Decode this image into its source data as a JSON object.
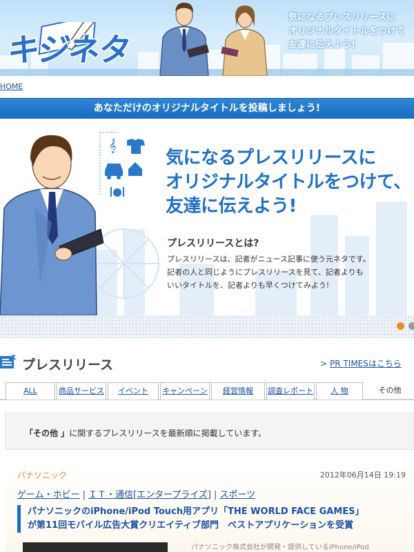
{
  "header": {
    "logo_text": "キジネタ",
    "tagline_lines": [
      "気になるプレスリリースに",
      "オリジナルタイトルをつけて",
      "友達に伝えよう!"
    ]
  },
  "breadcrumb": {
    "home": "HOME"
  },
  "banner": {
    "text": "あなただけのオリジナルタイトルを投稿しましょう!"
  },
  "hero": {
    "title_lines": [
      "気になるプレスリリースに",
      "オリジナルタイトルをつけて、",
      "友達に伝えよう!"
    ],
    "subheading": "プレスリリースとは?",
    "description_lines": [
      "プレスリリースは、記者がニュース記事に使う元ネタです。",
      "記者の人と同じようにプレスリリースを見て、記者よりも",
      "いいタイトルを、記者よりも早くつけてみよう!"
    ]
  },
  "slider": {
    "dots": 2,
    "active_index": 0
  },
  "press": {
    "section_title": "プレスリリース",
    "prtimes_link": "PR TIMESはこちら",
    "tabs": [
      "ALL",
      "商品サービス",
      "イベント",
      "キャンペーン",
      "経営情報",
      "調査レポート",
      "人 物",
      "その他"
    ],
    "active_tab": "その他",
    "info": {
      "prefix": "「その他 」",
      "suffix": "に関するプレスリリースを最新順に掲載しています。"
    },
    "article": {
      "company": "パナソニック",
      "date": "2012年06月14日 19:19",
      "categories": [
        "ゲーム・ホビー",
        "ＩＴ・通信[エンタープライズ]",
        "スポーツ"
      ],
      "title_lines": [
        "パナソニックのiPhone/iPod Touch用アプリ「THE WORLD FACE GAMES」",
        "が第11回モバイル広告大賞クリエイティブ部門　ベストアプリケーションを受賞"
      ],
      "excerpt": "パナソニック株式会社が開発・提供しているiPhone/iPod"
    }
  },
  "colors": {
    "brand_blue": "#1f6fc4",
    "banner_blue": "#1a6cc0",
    "company_orange": "#e08a2a",
    "slider_active": "#f08a24"
  }
}
